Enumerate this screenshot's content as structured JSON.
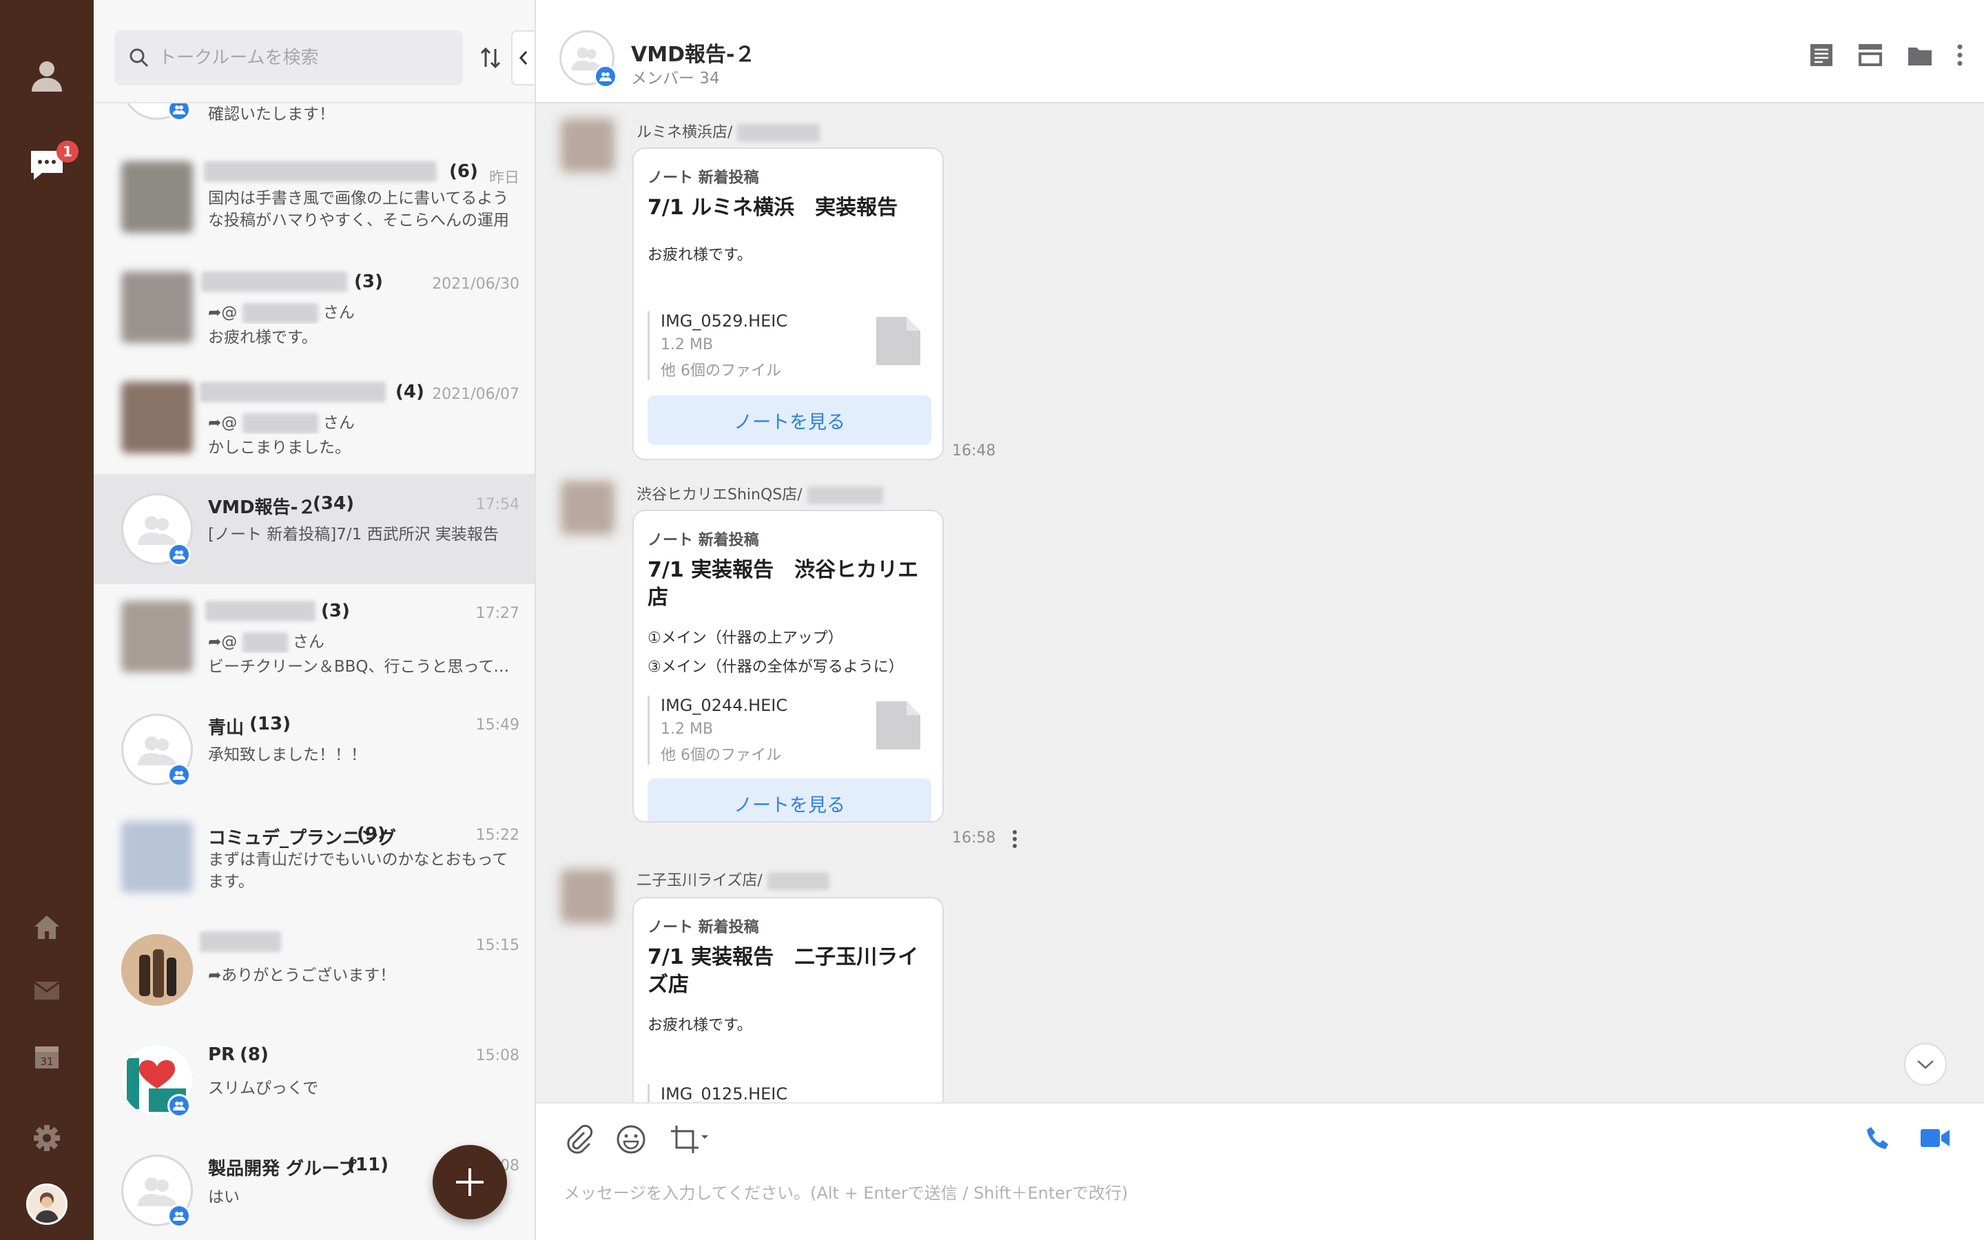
{
  "rail": {
    "chat_badge": "1",
    "icons": [
      "profile-icon",
      "chat-icon",
      "home-icon",
      "mail-icon",
      "calendar-icon",
      "settings-icon"
    ],
    "calendar_day": "31"
  },
  "search": {
    "placeholder": "トークルームを検索"
  },
  "rooms": [
    {
      "name": "",
      "count": "",
      "time": "",
      "line1": "確認いたします！",
      "line2": ""
    },
    {
      "name": "",
      "count": "(6)",
      "time": "昨日",
      "line1": "国内は手書き風で画像の上に書いてるような投稿がハマりやすく、そこらへんの運用は上…",
      "line2": ""
    },
    {
      "name": "",
      "count": "(3)",
      "time": "2021/06/30",
      "line1_prefix": "@",
      "line1_suffix": "さん",
      "line2": "お疲れ様です。"
    },
    {
      "name": "",
      "count": "(4)",
      "time": "2021/06/07",
      "line1_prefix": "@",
      "line1_suffix": "さん",
      "line2": "かしこまりました。"
    },
    {
      "name": "VMD報告-２",
      "count": "(34)",
      "time": "17:54",
      "line1": "[ノート 新着投稿]7/1 西武所沢 実装報告",
      "line2": ""
    },
    {
      "name": "",
      "count": "(3)",
      "time": "17:27",
      "line1_prefix": "@",
      "line1_suffix": "さん",
      "line2": "ビーチクリーン＆BBQ、行こうと思ってま…"
    },
    {
      "name": "青山",
      "count": "(13)",
      "time": "15:49",
      "line1": "承知致しました！！！",
      "line2": ""
    },
    {
      "name": "コミュデ_プランニング",
      "count": "(9)",
      "time": "15:22",
      "line1": "まずは青山だけでもいいのかなとおもってます。",
      "line2": ""
    },
    {
      "name": "",
      "count": "",
      "time": "15:15",
      "line1": "ありがとうございます！",
      "line2": ""
    },
    {
      "name": "PR",
      "count": "(8)",
      "time": "15:08",
      "line1": "スリムぴっくで",
      "line2": ""
    },
    {
      "name": "製品開発 グループ",
      "count": "(11)",
      "time": "08",
      "line1": "はい",
      "line2": ""
    }
  ],
  "chat": {
    "title": "VMD報告-２",
    "members": "メンバー 34",
    "messages": [
      {
        "sender": "ルミネ横浜店/",
        "kind": "ノート 新着投稿",
        "title": "7/1 ルミネ横浜　実装報告",
        "body": [
          "お疲れ様です。"
        ],
        "file_name": "IMG_0529.HEIC",
        "file_size": "1.2 MB",
        "file_more": "他 6個のファイル",
        "button": "ノートを見る",
        "time": "16:48"
      },
      {
        "sender": "渋谷ヒカリエShinQS店/",
        "kind": "ノート 新着投稿",
        "title": "7/1 実装報告　渋谷ヒカリエ店",
        "body": [
          "①メイン（什器の上アップ）",
          "③メイン（什器の全体が写るように）"
        ],
        "file_name": "IMG_0244.HEIC",
        "file_size": "1.2 MB",
        "file_more": "他 6個のファイル",
        "button": "ノートを見る",
        "time": "16:58"
      },
      {
        "sender": "二子玉川ライズ店/",
        "kind": "ノート 新着投稿",
        "title": "7/1 実装報告　二子玉川ライズ店",
        "body": [
          "お疲れ様です。"
        ],
        "file_name": "IMG_0125.HEIC",
        "file_size": "",
        "file_more": "",
        "button": "",
        "time": ""
      }
    ]
  },
  "composer": {
    "placeholder": "メッセージを入力してください。(Alt + Enterで送信 / Shift＋Enterで改行)"
  },
  "colors": {
    "rail": "#4a2a1d",
    "accent": "#2d7fe8",
    "badge": "#e04a4a"
  }
}
